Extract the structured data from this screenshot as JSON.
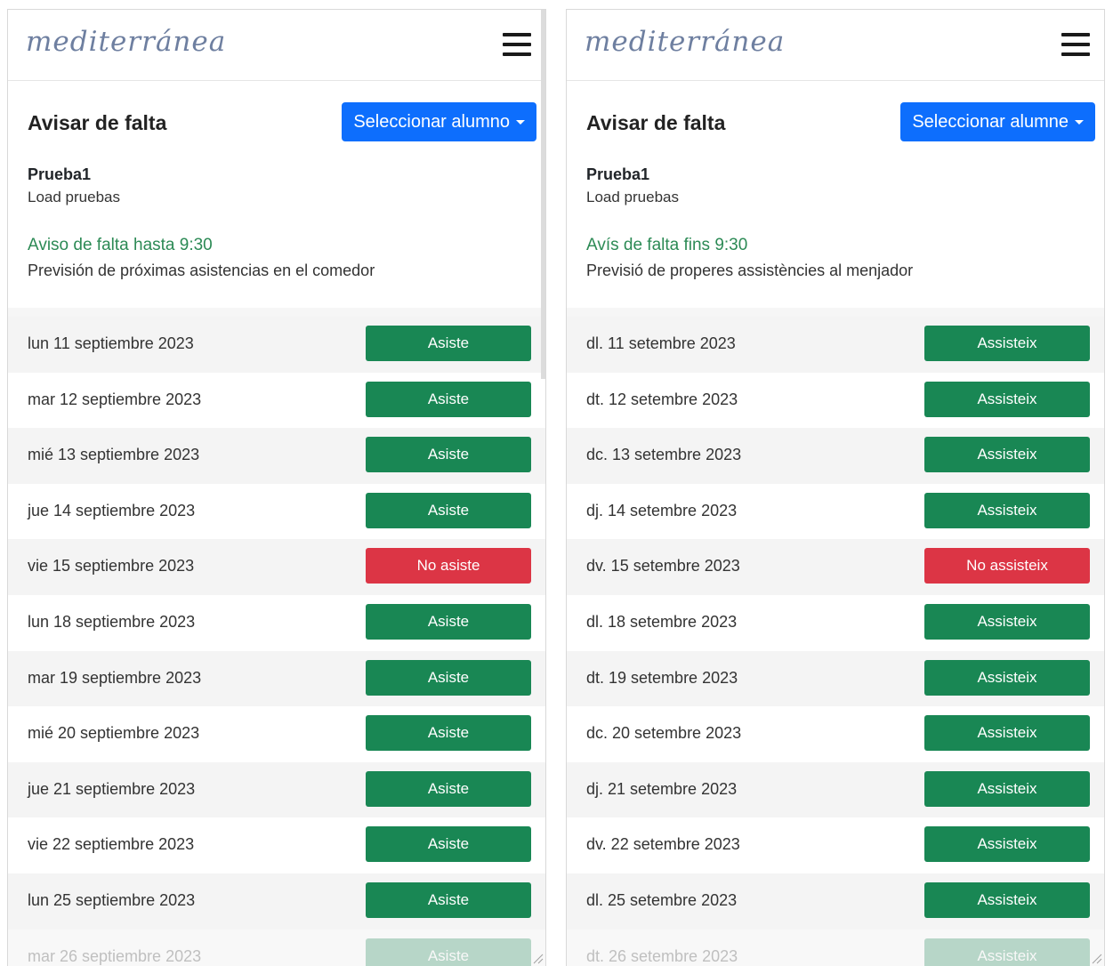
{
  "colors": {
    "primary": "#0d6efd",
    "success": "#198754",
    "danger": "#dc3545",
    "notice_green": "#2c8a55"
  },
  "panels": [
    {
      "language": "es",
      "logo_text": "mediterránea",
      "menu_icon": "hamburger-menu-icon",
      "card_title": "Avisar de falta",
      "select_button": "Seleccionar alumno",
      "student_name": "Prueba1",
      "student_group": "Load pruebas",
      "notice_deadline": "Aviso de falta hasta 9:30",
      "forecast_text": "Previsión de próximas asistencias en el comedor",
      "days": [
        {
          "date": "lun 11 septiembre 2023",
          "status": "Asiste",
          "state": "attends"
        },
        {
          "date": "mar 12 septiembre 2023",
          "status": "Asiste",
          "state": "attends"
        },
        {
          "date": "mié 13 septiembre 2023",
          "status": "Asiste",
          "state": "attends"
        },
        {
          "date": "jue 14 septiembre 2023",
          "status": "Asiste",
          "state": "attends"
        },
        {
          "date": "vie 15 septiembre 2023",
          "status": "No asiste",
          "state": "absent"
        },
        {
          "date": "lun 18 septiembre 2023",
          "status": "Asiste",
          "state": "attends"
        },
        {
          "date": "mar 19 septiembre 2023",
          "status": "Asiste",
          "state": "attends"
        },
        {
          "date": "mié 20 septiembre 2023",
          "status": "Asiste",
          "state": "attends"
        },
        {
          "date": "jue 21 septiembre 2023",
          "status": "Asiste",
          "state": "attends"
        },
        {
          "date": "vie 22 septiembre 2023",
          "status": "Asiste",
          "state": "attends"
        },
        {
          "date": "lun 25 septiembre 2023",
          "status": "Asiste",
          "state": "attends"
        },
        {
          "date": "mar 26 septiembre 2023",
          "status": "Asiste",
          "state": "attends"
        }
      ]
    },
    {
      "language": "ca",
      "logo_text": "mediterránea",
      "menu_icon": "hamburger-menu-icon",
      "card_title": "Avisar de falta",
      "select_button": "Seleccionar alumne",
      "student_name": "Prueba1",
      "student_group": "Load pruebas",
      "notice_deadline": "Avís de falta fins 9:30",
      "forecast_text": "Previsió de properes assistències al menjador",
      "days": [
        {
          "date": "dl. 11 setembre 2023",
          "status": "Assisteix",
          "state": "attends"
        },
        {
          "date": "dt. 12 setembre 2023",
          "status": "Assisteix",
          "state": "attends"
        },
        {
          "date": "dc. 13 setembre 2023",
          "status": "Assisteix",
          "state": "attends"
        },
        {
          "date": "dj. 14 setembre 2023",
          "status": "Assisteix",
          "state": "attends"
        },
        {
          "date": "dv. 15 setembre 2023",
          "status": "No assisteix",
          "state": "absent"
        },
        {
          "date": "dl. 18 setembre 2023",
          "status": "Assisteix",
          "state": "attends"
        },
        {
          "date": "dt. 19 setembre 2023",
          "status": "Assisteix",
          "state": "attends"
        },
        {
          "date": "dc. 20 setembre 2023",
          "status": "Assisteix",
          "state": "attends"
        },
        {
          "date": "dj. 21 setembre 2023",
          "status": "Assisteix",
          "state": "attends"
        },
        {
          "date": "dv. 22 setembre 2023",
          "status": "Assisteix",
          "state": "attends"
        },
        {
          "date": "dl. 25 setembre 2023",
          "status": "Assisteix",
          "state": "attends"
        },
        {
          "date": "dt. 26 setembre 2023",
          "status": "Assisteix",
          "state": "attends"
        }
      ]
    }
  ]
}
